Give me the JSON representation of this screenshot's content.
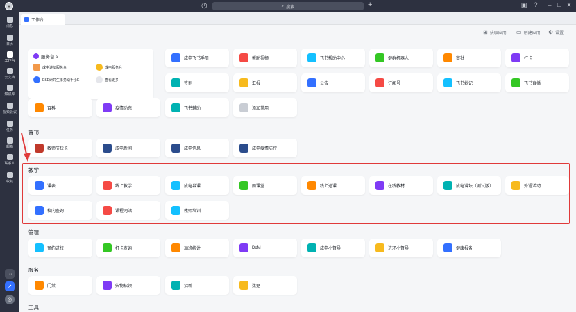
{
  "titlebar": {
    "search_placeholder": "搜索"
  },
  "sidebar": {
    "items": [
      "消息",
      "日历",
      "工作台",
      "云文档",
      "知识库",
      "视频会议",
      "任务",
      "邮箱",
      "联系人",
      "收藏"
    ]
  },
  "tab": {
    "label": "工作台"
  },
  "toolbar": {
    "get_apps": "获取应用",
    "create_app": "创建应用",
    "settings": "设置"
  },
  "workspace": {
    "title": "服务台 >",
    "items": [
      "成电讲坛服务台",
      "成电服务台",
      "ESE研究生事务助手小E",
      "查看更多"
    ]
  },
  "frequent": [
    "成电飞书手册",
    "帮助视频",
    "飞书帮助中心",
    "健群机器人",
    "审批",
    "打卡",
    "签到",
    "汇报",
    "公告",
    "订阅号",
    "飞书妙记",
    "飞书直播",
    "百科",
    "疫情动态",
    "飞书辅助",
    "添加常用"
  ],
  "sections": {
    "pinned": "置顶",
    "teaching": "教学",
    "management": "管理",
    "service": "服务",
    "tools": "工具"
  },
  "pinned": [
    "教师节快卡",
    "成电新闻",
    "成电信息",
    "成电疫情防控"
  ],
  "teaching": [
    "课表",
    "线上教学",
    "成电慕课",
    "雨课堂",
    "线上巡课",
    "在线教材",
    "成电讲坛（测试版）",
    "外语活动",
    "校内查询",
    "课程网站",
    "教师培训"
  ],
  "management": [
    "预约进校",
    "打卡查询",
    "加班统计",
    "DoM",
    "成电小督导",
    "进环小督导",
    "健康报备"
  ],
  "service": [
    "门禁",
    "失物招领",
    "招新",
    "数据"
  ]
}
